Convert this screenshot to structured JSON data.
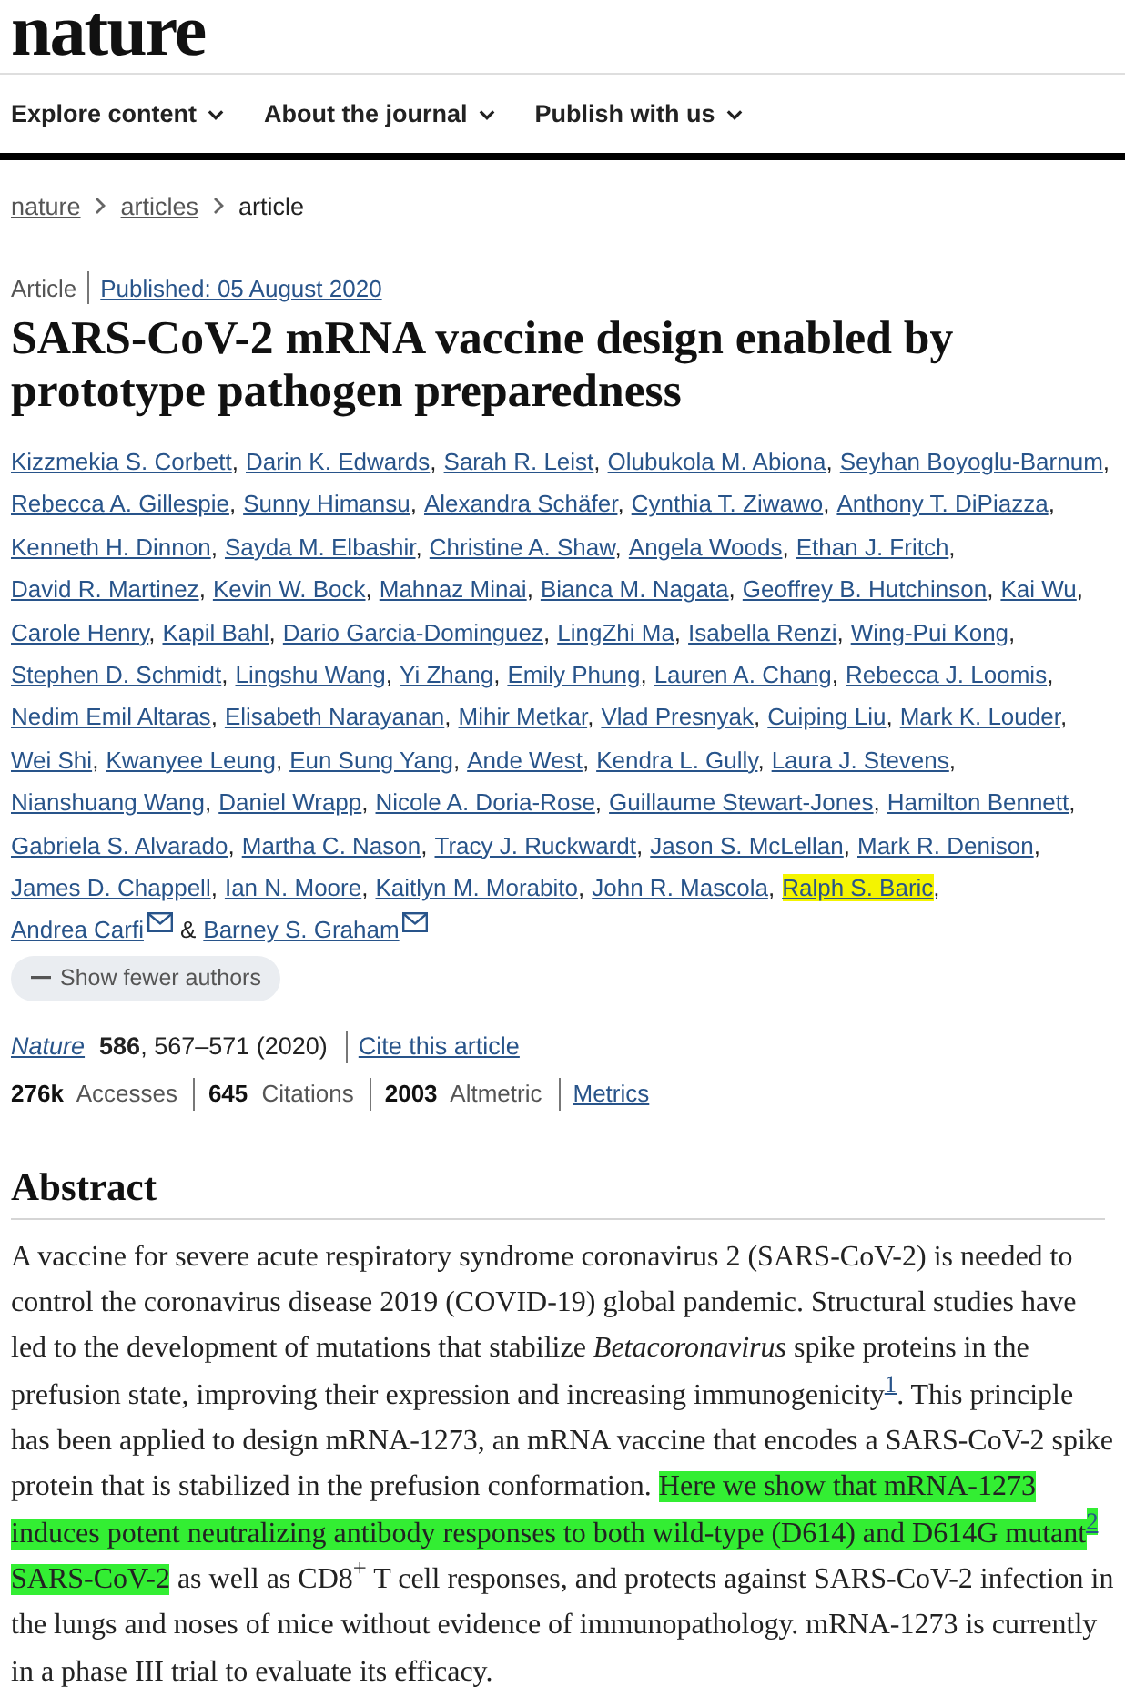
{
  "site": {
    "logo": "nature"
  },
  "nav": [
    {
      "label": "Explore content"
    },
    {
      "label": "About the journal"
    },
    {
      "label": "Publish with us"
    }
  ],
  "breadcrumb": [
    {
      "label": "nature",
      "current": false
    },
    {
      "label": "articles",
      "current": false
    },
    {
      "label": "article",
      "current": true
    }
  ],
  "article": {
    "type": "Article",
    "published": "Published: 05 August 2020",
    "title": "SARS-CoV-2 mRNA vaccine design enabled by prototype pathogen preparedness",
    "authors": [
      {
        "name": "Kizzmekia S. Corbett",
        "sep": ",",
        "email": false,
        "highlighted": false
      },
      {
        "name": "Darin K. Edwards",
        "sep": ",",
        "email": false,
        "highlighted": false
      },
      {
        "name": "Sarah R. Leist",
        "sep": ",",
        "email": false,
        "highlighted": false
      },
      {
        "name": "Olubukola M. Abiona",
        "sep": ",",
        "email": false,
        "highlighted": false
      },
      {
        "name": "Seyhan Boyoglu-Barnum",
        "sep": ",",
        "email": false,
        "highlighted": false
      },
      {
        "name": "Rebecca A. Gillespie",
        "sep": ",",
        "email": false,
        "highlighted": false
      },
      {
        "name": "Sunny Himansu",
        "sep": ",",
        "email": false,
        "highlighted": false
      },
      {
        "name": "Alexandra Schäfer",
        "sep": ",",
        "email": false,
        "highlighted": false
      },
      {
        "name": "Cynthia T. Ziwawo",
        "sep": ",",
        "email": false,
        "highlighted": false
      },
      {
        "name": "Anthony T. DiPiazza",
        "sep": ",",
        "email": false,
        "highlighted": false
      },
      {
        "name": "Kenneth H. Dinnon",
        "sep": ",",
        "email": false,
        "highlighted": false
      },
      {
        "name": "Sayda M. Elbashir",
        "sep": ",",
        "email": false,
        "highlighted": false
      },
      {
        "name": "Christine A. Shaw",
        "sep": ",",
        "email": false,
        "highlighted": false
      },
      {
        "name": "Angela Woods",
        "sep": ",",
        "email": false,
        "highlighted": false
      },
      {
        "name": "Ethan J. Fritch",
        "sep": ",",
        "email": false,
        "highlighted": false
      },
      {
        "name": "David R. Martinez",
        "sep": ",",
        "email": false,
        "highlighted": false
      },
      {
        "name": "Kevin W. Bock",
        "sep": ",",
        "email": false,
        "highlighted": false
      },
      {
        "name": "Mahnaz Minai",
        "sep": ",",
        "email": false,
        "highlighted": false
      },
      {
        "name": "Bianca M. Nagata",
        "sep": ",",
        "email": false,
        "highlighted": false
      },
      {
        "name": "Geoffrey B. Hutchinson",
        "sep": ",",
        "email": false,
        "highlighted": false
      },
      {
        "name": "Kai Wu",
        "sep": ",",
        "email": false,
        "highlighted": false
      },
      {
        "name": "Carole Henry",
        "sep": ",",
        "email": false,
        "highlighted": false
      },
      {
        "name": "Kapil Bahl",
        "sep": ",",
        "email": false,
        "highlighted": false
      },
      {
        "name": "Dario Garcia-Dominguez",
        "sep": ",",
        "email": false,
        "highlighted": false
      },
      {
        "name": "LingZhi Ma",
        "sep": ",",
        "email": false,
        "highlighted": false
      },
      {
        "name": "Isabella Renzi",
        "sep": ",",
        "email": false,
        "highlighted": false
      },
      {
        "name": "Wing-Pui Kong",
        "sep": ",",
        "email": false,
        "highlighted": false
      },
      {
        "name": "Stephen D. Schmidt",
        "sep": ",",
        "email": false,
        "highlighted": false
      },
      {
        "name": "Lingshu Wang",
        "sep": ",",
        "email": false,
        "highlighted": false
      },
      {
        "name": "Yi Zhang",
        "sep": ",",
        "email": false,
        "highlighted": false
      },
      {
        "name": "Emily Phung",
        "sep": ",",
        "email": false,
        "highlighted": false
      },
      {
        "name": "Lauren A. Chang",
        "sep": ",",
        "email": false,
        "highlighted": false
      },
      {
        "name": "Rebecca J. Loomis",
        "sep": ",",
        "email": false,
        "highlighted": false
      },
      {
        "name": "Nedim Emil Altaras",
        "sep": ",",
        "email": false,
        "highlighted": false
      },
      {
        "name": "Elisabeth Narayanan",
        "sep": ",",
        "email": false,
        "highlighted": false
      },
      {
        "name": "Mihir Metkar",
        "sep": ",",
        "email": false,
        "highlighted": false
      },
      {
        "name": "Vlad Presnyak",
        "sep": ",",
        "email": false,
        "highlighted": false
      },
      {
        "name": "Cuiping Liu",
        "sep": ",",
        "email": false,
        "highlighted": false
      },
      {
        "name": "Mark K. Louder",
        "sep": ",",
        "email": false,
        "highlighted": false
      },
      {
        "name": "Wei Shi",
        "sep": ",",
        "email": false,
        "highlighted": false
      },
      {
        "name": "Kwanyee Leung",
        "sep": ",",
        "email": false,
        "highlighted": false
      },
      {
        "name": "Eun Sung Yang",
        "sep": ",",
        "email": false,
        "highlighted": false
      },
      {
        "name": "Ande West",
        "sep": ",",
        "email": false,
        "highlighted": false
      },
      {
        "name": "Kendra L. Gully",
        "sep": ",",
        "email": false,
        "highlighted": false
      },
      {
        "name": "Laura J. Stevens",
        "sep": ",",
        "email": false,
        "highlighted": false
      },
      {
        "name": "Nianshuang Wang",
        "sep": ",",
        "email": false,
        "highlighted": false
      },
      {
        "name": "Daniel Wrapp",
        "sep": ",",
        "email": false,
        "highlighted": false
      },
      {
        "name": "Nicole A. Doria-Rose",
        "sep": ",",
        "email": false,
        "highlighted": false
      },
      {
        "name": "Guillaume Stewart-Jones",
        "sep": ",",
        "email": false,
        "highlighted": false
      },
      {
        "name": "Hamilton Bennett",
        "sep": ",",
        "email": false,
        "highlighted": false
      },
      {
        "name": "Gabriela S. Alvarado",
        "sep": ",",
        "email": false,
        "highlighted": false
      },
      {
        "name": "Martha C. Nason",
        "sep": ",",
        "email": false,
        "highlighted": false
      },
      {
        "name": "Tracy J. Ruckwardt",
        "sep": ",",
        "email": false,
        "highlighted": false
      },
      {
        "name": "Jason S. McLellan",
        "sep": ",",
        "email": false,
        "highlighted": false
      },
      {
        "name": "Mark R. Denison",
        "sep": ",",
        "email": false,
        "highlighted": false
      },
      {
        "name": "James D. Chappell",
        "sep": ",",
        "email": false,
        "highlighted": false
      },
      {
        "name": "Ian N. Moore",
        "sep": ",",
        "email": false,
        "highlighted": false
      },
      {
        "name": "Kaitlyn M. Morabito",
        "sep": ",",
        "email": false,
        "highlighted": false
      },
      {
        "name": "John R. Mascola",
        "sep": ",",
        "email": false,
        "highlighted": false
      },
      {
        "name": "Ralph S. Baric",
        "sep": ",",
        "email": false,
        "highlighted": true
      },
      {
        "name": "Andrea Carfi",
        "sep": "&",
        "email": true,
        "highlighted": false
      },
      {
        "name": "Barney S. Graham",
        "email": true,
        "highlighted": false
      }
    ],
    "show_authors_button": "Show fewer authors",
    "journal": "Nature",
    "citation": "**586**, 567–571 (2020)",
    "cite_link": "Cite this article",
    "metrics": [
      {
        "text": "**276k** Accesses"
      },
      {
        "text": "**645** Citations"
      },
      {
        "text": "**2003** Altmetric"
      }
    ],
    "metrics_link": "Metrics"
  },
  "abstract": {
    "heading": "Abstract",
    "segments": [
      {
        "kind": "text",
        "text": "A vaccine for severe acute respiratory syndrome coronavirus 2 (SARS-CoV-2) is needed to control the coronavirus disease 2019 (COVID-19) global pandemic. Structural studies have led to the development of mutations that stabilize *Betacoronavirus* spike proteins in the prefusion state, improving their expression and increasing immunogenicity",
        "highlighted": false
      },
      {
        "kind": "ref",
        "text": "1",
        "highlighted": false
      },
      {
        "kind": "text",
        "text": ". This principle has been applied to design mRNA-1273, an mRNA vaccine that encodes a SARS-CoV-2 spike protein that is stabilized in the prefusion conformation. ",
        "highlighted": false
      },
      {
        "kind": "text",
        "text": "Here we show that mRNA-1273 induces potent neutralizing antibody responses to both wild-type (D614) and D614G mutant",
        "highlighted": true
      },
      {
        "kind": "ref",
        "text": "2",
        "highlighted": true
      },
      {
        "kind": "text",
        "text": " SARS-CoV-2",
        "highlighted": true
      },
      {
        "kind": "text",
        "text": " as well as CD8$^{+}$ T cell responses, and protects against SARS-CoV-2 infection in the lungs and noses of mice without evidence of immunopathology. mRNA-1273 is currently in a phase III trial to evaluate its efficacy.",
        "highlighted": false
      }
    ]
  }
}
